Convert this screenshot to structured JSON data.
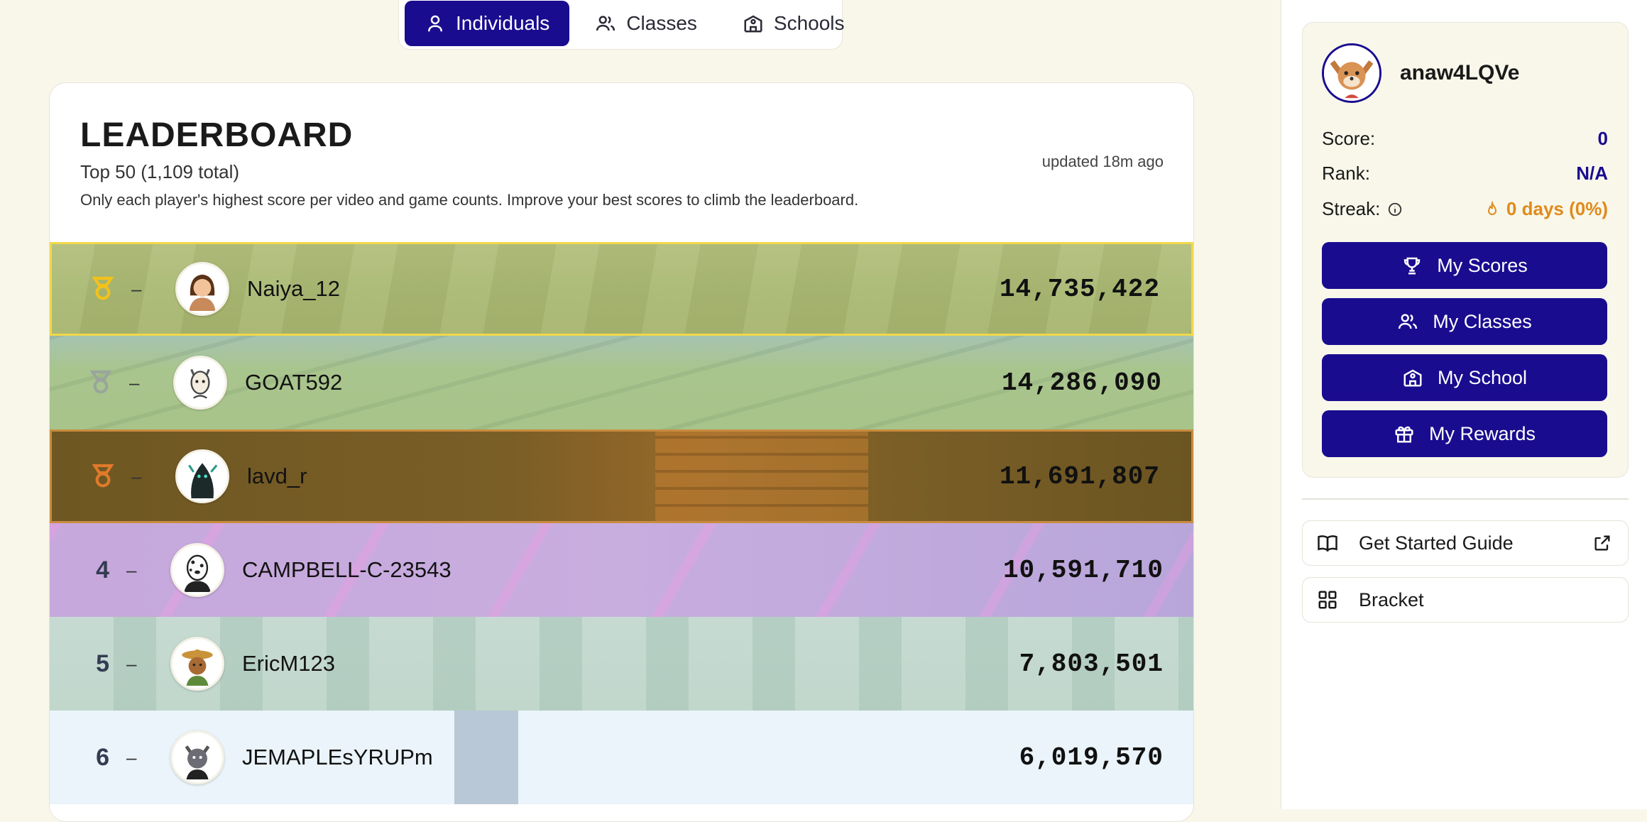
{
  "tabs": [
    {
      "label": "Individuals",
      "icon": "person-icon",
      "active": true
    },
    {
      "label": "Classes",
      "icon": "people-icon",
      "active": false
    },
    {
      "label": "Schools",
      "icon": "school-icon",
      "active": false
    }
  ],
  "leaderboard": {
    "title": "LEADERBOARD",
    "subtitle": "Top 50 (1,109 total)",
    "note": "Only each player's highest score per video and game counts. Improve your best scores to climb the leaderboard.",
    "updated": "updated 18m ago",
    "rows": [
      {
        "rank": "",
        "medal": "gold",
        "change": "–",
        "name": "Naiya_12",
        "score": "14,735,422"
      },
      {
        "rank": "",
        "medal": "silver",
        "change": "–",
        "name": "GOAT592",
        "score": "14,286,090"
      },
      {
        "rank": "",
        "medal": "bronze",
        "change": "–",
        "name": "lavd_r",
        "score": "11,691,807"
      },
      {
        "rank": "4",
        "medal": "",
        "change": "–",
        "name": "CAMPBELL-C-23543",
        "score": "10,591,710"
      },
      {
        "rank": "5",
        "medal": "",
        "change": "–",
        "name": "EricM123",
        "score": "7,803,501"
      },
      {
        "rank": "6",
        "medal": "",
        "change": "–",
        "name": "JEMAPLEsYRUPm",
        "score": "6,019,570"
      }
    ]
  },
  "profile": {
    "username": "anaw4LQVe",
    "score_label": "Score:",
    "score_value": "0",
    "rank_label": "Rank:",
    "rank_value": "N/A",
    "streak_label": "Streak:",
    "streak_value": "0 days (0%)",
    "buttons": [
      {
        "label": "My Scores",
        "icon": "trophy-icon"
      },
      {
        "label": "My Classes",
        "icon": "people-icon"
      },
      {
        "label": "My School",
        "icon": "school-icon"
      },
      {
        "label": "My Rewards",
        "icon": "gift-icon"
      }
    ]
  },
  "links": [
    {
      "label": "Get Started Guide",
      "icon": "book-icon",
      "external": true
    },
    {
      "label": "Bracket",
      "icon": "grid-icon",
      "external": false
    }
  ],
  "colors": {
    "accent": "#1a0c8f",
    "streak": "#e08a1c",
    "background": "#f8f7ea"
  }
}
